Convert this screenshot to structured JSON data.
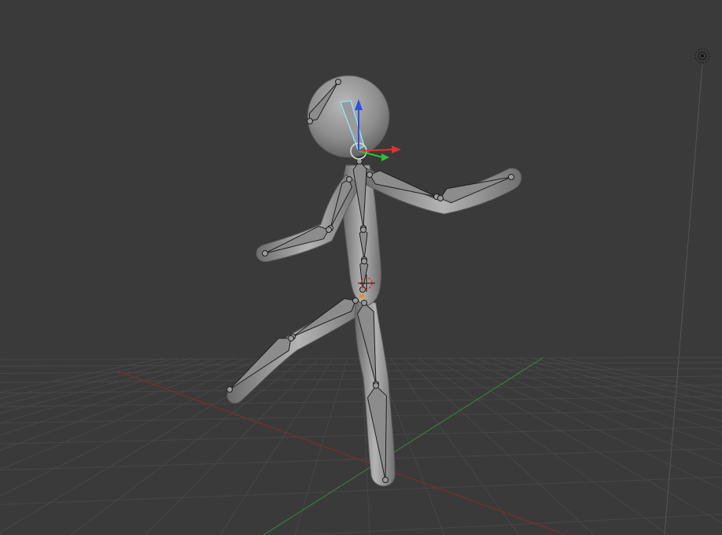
{
  "viewport": {
    "mode": "pose",
    "background": "#3a3a3a",
    "grid_color": "#4a4a4a",
    "x_axis_color": "#8a3030",
    "y_axis_color": "#3f8a3f"
  },
  "scene": {
    "mesh_color": "#9a9a9a",
    "bone_color": "#3a3a3a",
    "selected_bone_color": "#8fe0e8",
    "cursor_icon": "3d-cursor-icon",
    "light_icon": "lamp-icon"
  },
  "gizmo": {
    "x_color": "#e23030",
    "y_color": "#30c030",
    "z_color": "#3050e0",
    "icon": "transform-manipulator-icon"
  }
}
